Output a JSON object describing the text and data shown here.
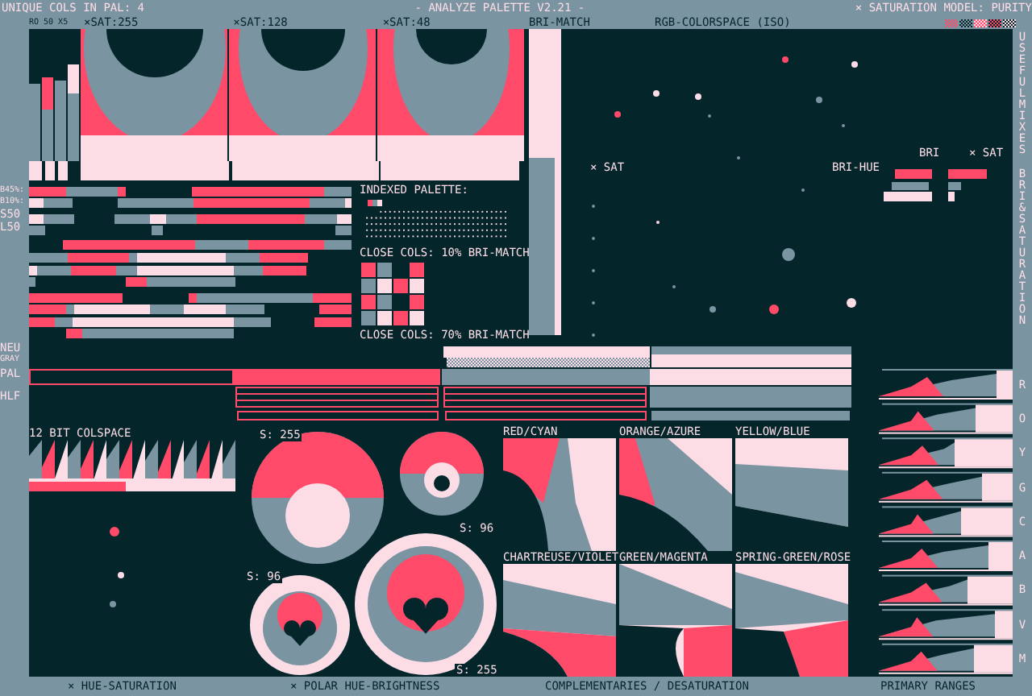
{
  "header": {
    "unique_count": "UNIQUE COLS IN PAL: 4",
    "title": "- ANALYZE PALETTE V2.21 -",
    "model": "× SATURATION MODEL: PURITY"
  },
  "subheader": {
    "mode": "RO 50 X5",
    "sat_labels": [
      "×SAT:255",
      "×SAT:128",
      "×SAT:48"
    ],
    "bri_match": "BRI-MATCH",
    "rgb": "RGB-COLORSPACE (ISO)"
  },
  "side_labels": {
    "bars": [
      "B45%:",
      "B10%:",
      "S50",
      "L50"
    ],
    "neutral": [
      "NEU",
      "GRAY"
    ],
    "pal": "PAL",
    "hlf": "HLF"
  },
  "rgb_space": {
    "labels": [
      "× SAT",
      "BRI-HUE",
      "BRI",
      "× SAT"
    ]
  },
  "palette_panel": {
    "title": "INDEXED PALETTE:",
    "swatches": [
      {
        "color": "#ff4a6a"
      },
      {
        "color": "#7a94a2"
      },
      {
        "color": "#fcdde6"
      }
    ],
    "close_10": "CLOSE COLS: 10% BRI-MATCH",
    "close_70": "CLOSE COLS: 70% BRI-MATCH"
  },
  "colspace": {
    "title": "12 BIT COLSPACE"
  },
  "polar": {
    "labels": [
      "S: 255",
      "S: 96",
      "S: 96",
      "S: 255"
    ]
  },
  "complementaries": [
    {
      "label": "RED/CYAN"
    },
    {
      "label": "ORANGE/AZURE"
    },
    {
      "label": "YELLOW/BLUE"
    },
    {
      "label": "CHARTREUSE/VIOLET"
    },
    {
      "label": "GREEN/MAGENTA"
    },
    {
      "label": "SPRING-GREEN/ROSE"
    }
  ],
  "side_tabs": {
    "mixes": "USEFUL MIXES",
    "bri_sat": "BRI & SATURATION",
    "ranges": [
      "R",
      "O",
      "Y",
      "G",
      "C",
      "A",
      "B",
      "V",
      "M"
    ]
  },
  "footer": [
    "× HUE-SATURATION",
    "× POLAR HUE-BRIGHTNESS",
    "COMPLEMENTARIES / DESATURATION",
    "PRIMARY RANGES"
  ]
}
